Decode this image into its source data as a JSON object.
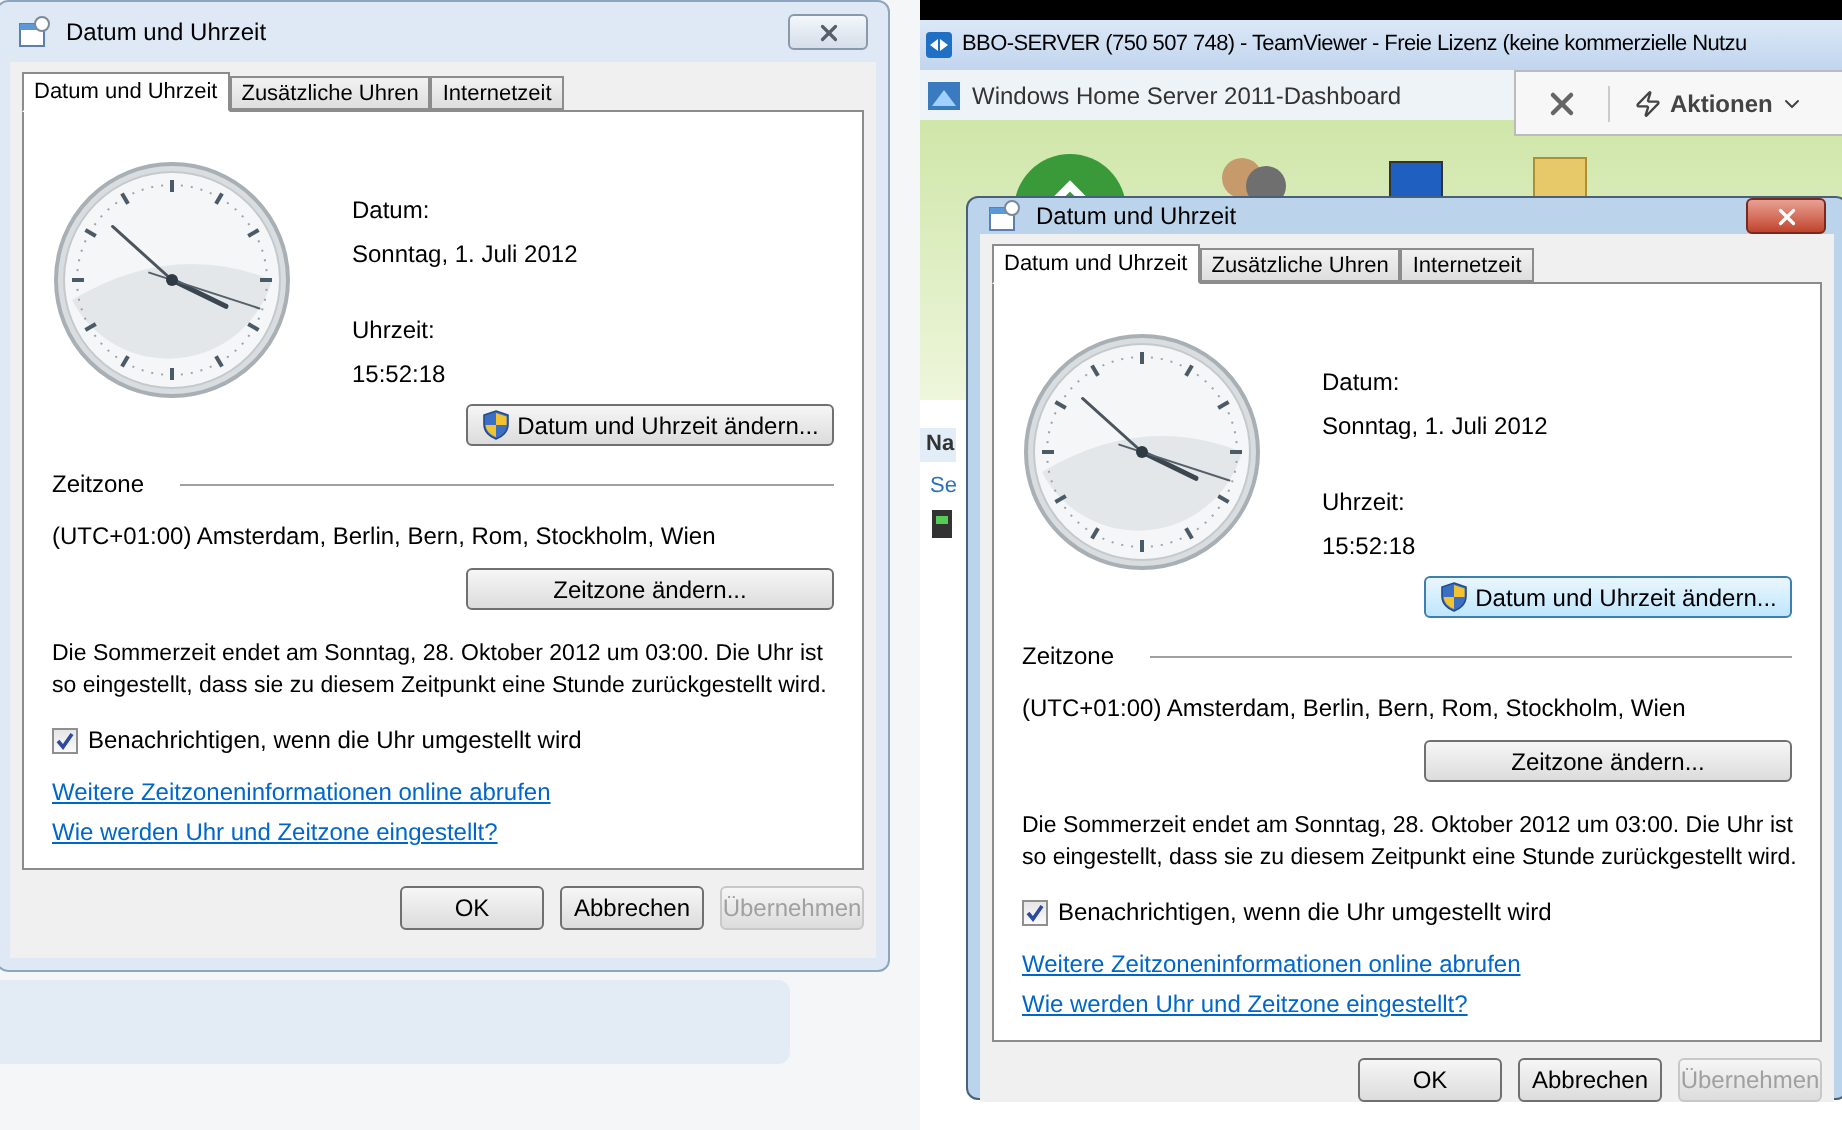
{
  "local_dialog": {
    "title": "Datum und Uhrzeit",
    "active": false,
    "tabs": [
      {
        "label": "Datum und Uhrzeit",
        "selected": true
      },
      {
        "label": "Zusätzliche Uhren",
        "selected": false
      },
      {
        "label": "Internetzeit",
        "selected": false
      }
    ],
    "date_label": "Datum:",
    "date_value": "Sonntag, 1. Juli 2012",
    "time_label": "Uhrzeit:",
    "time_value": "15:52:18",
    "change_datetime_button": {
      "label": "Datum und Uhrzeit ändern...",
      "focused": false
    },
    "timezone_heading": "Zeitzone",
    "timezone_value": "(UTC+01:00) Amsterdam, Berlin, Bern, Rom, Stockholm, Wien",
    "change_timezone_button": "Zeitzone ändern...",
    "dst_notice": "Die Sommerzeit endet am Sonntag, 28. Oktober 2012 um 03:00. Die Uhr ist so eingestellt, dass sie zu diesem Zeitpunkt eine Stunde zurückgestellt wird.",
    "notify_checkbox": {
      "label": "Benachrichtigen, wenn die Uhr umgestellt wird",
      "checked": true
    },
    "links": [
      "Weitere Zeitzoneninformationen online abrufen",
      "Wie werden Uhr und Zeitzone eingestellt?"
    ],
    "buttons": [
      {
        "label": "OK",
        "disabled": false
      },
      {
        "label": "Abbrechen",
        "disabled": false
      },
      {
        "label": "Übernehmen",
        "disabled": true
      }
    ]
  },
  "teamviewer": {
    "title": "BBO-SERVER (750 507 748) - TeamViewer - Freie Lizenz (keine kommerzielle Nutzu",
    "dashboard_title": "Windows Home Server 2011-Dashboard",
    "actions_button": "Aktionen",
    "sidebar_texts": [
      "Na",
      "Se"
    ],
    "remote_dialog": {
      "title": "Datum und Uhrzeit",
      "active": true,
      "tabs": [
        {
          "label": "Datum und Uhrzeit",
          "selected": true
        },
        {
          "label": "Zusätzliche Uhren",
          "selected": false
        },
        {
          "label": "Internetzeit",
          "selected": false
        }
      ],
      "date_label": "Datum:",
      "date_value": "Sonntag, 1. Juli 2012",
      "time_label": "Uhrzeit:",
      "time_value": "15:52:18",
      "change_datetime_button": {
        "label": "Datum und Uhrzeit ändern...",
        "focused": true
      },
      "timezone_heading": "Zeitzone",
      "timezone_value": "(UTC+01:00) Amsterdam, Berlin, Bern, Rom, Stockholm, Wien",
      "change_timezone_button": "Zeitzone ändern...",
      "dst_notice": "Die Sommerzeit endet am Sonntag, 28. Oktober 2012 um 03:00. Die Uhr ist so eingestellt, dass sie zu diesem Zeitpunkt eine Stunde zurückgestellt wird.",
      "notify_checkbox": {
        "label": "Benachrichtigen, wenn die Uhr umgestellt wird",
        "checked": true
      },
      "links": [
        "Weitere Zeitzoneninformationen online abrufen",
        "Wie werden Uhr und Zeitzone eingestellt?"
      ],
      "buttons": [
        {
          "label": "OK",
          "disabled": false
        },
        {
          "label": "Abbrechen",
          "disabled": false
        },
        {
          "label": "Übernehmen",
          "disabled": true
        }
      ]
    }
  }
}
